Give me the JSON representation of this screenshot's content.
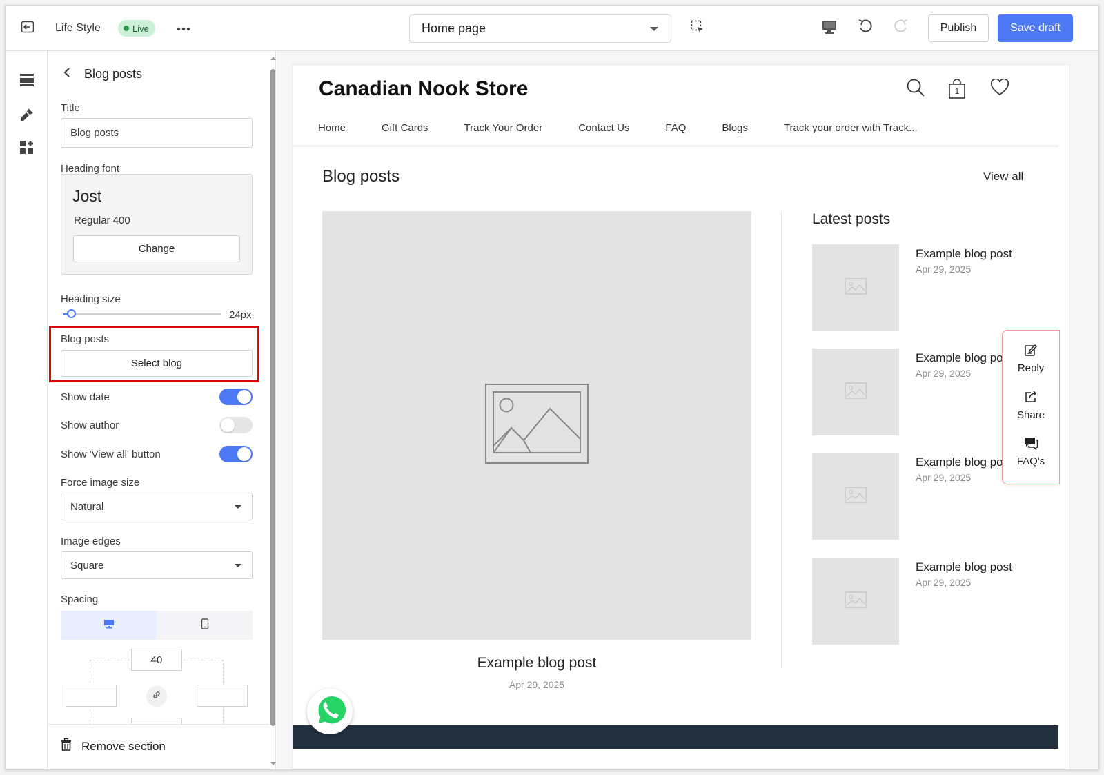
{
  "topbar": {
    "theme_name": "Life Style",
    "live_badge": "Live",
    "page_selector": "Home page",
    "publish_label": "Publish",
    "save_draft_label": "Save draft",
    "accent_color": "#4d79f4"
  },
  "rail": {
    "icons": [
      "sections-icon",
      "theme-brush-icon",
      "apps-icon"
    ]
  },
  "panel": {
    "title": "Blog posts",
    "title_field": {
      "label": "Title",
      "value": "Blog posts"
    },
    "heading_font": {
      "label": "Heading font",
      "font_name": "Jost",
      "font_weight": "Regular 400",
      "change_label": "Change"
    },
    "heading_size": {
      "label": "Heading size",
      "value_text": "24px",
      "slider_fraction": 0.05
    },
    "blog_posts": {
      "label": "Blog posts",
      "button_label": "Select blog"
    },
    "toggles": [
      {
        "label": "Show date",
        "on": true
      },
      {
        "label": "Show author",
        "on": false
      },
      {
        "label": "Show 'View all' button",
        "on": true
      }
    ],
    "force_image_size": {
      "label": "Force image size",
      "value": "Natural"
    },
    "image_edges": {
      "label": "Image edges",
      "value": "Square"
    },
    "spacing": {
      "label": "Spacing",
      "top": "40",
      "left": "",
      "right": "",
      "bottom": ""
    },
    "remove_label": "Remove section",
    "highlight_color": "#e10600"
  },
  "preview": {
    "store_name": "Canadian Nook Store",
    "cart_count": "1",
    "nav": [
      "Home",
      "Gift Cards",
      "Track Your Order",
      "Contact Us",
      "FAQ",
      "Blogs",
      "Track your order with Track..."
    ],
    "section_title": "Blog posts",
    "view_all": "View all",
    "featured": {
      "title": "Example blog post",
      "date": "Apr 29, 2025"
    },
    "latest_title": "Latest posts",
    "latest_posts": [
      {
        "title": "Example blog post",
        "date": "Apr 29, 2025"
      },
      {
        "title": "Example blog post",
        "date": "Apr 29, 2025"
      },
      {
        "title": "Example blog post",
        "date": "Apr 29, 2025"
      },
      {
        "title": "Example blog post",
        "date": "Apr 29, 2025"
      }
    ],
    "floating_actions": [
      {
        "label": "Reply",
        "icon": "reply-edit-icon"
      },
      {
        "label": "Share",
        "icon": "share-icon"
      },
      {
        "label": "FAQ's",
        "icon": "faq-icon"
      }
    ],
    "footer_color": "#223040",
    "whatsapp_color": "#25d366"
  }
}
